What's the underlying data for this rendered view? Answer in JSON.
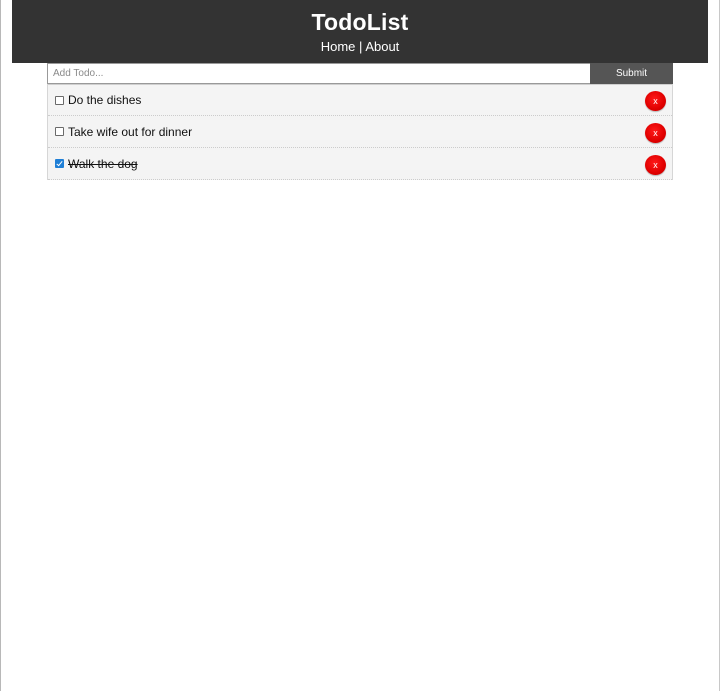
{
  "app": {
    "title": "TodoList"
  },
  "nav": {
    "home_label": "Home",
    "separator": "|",
    "about_label": "About"
  },
  "add_form": {
    "placeholder": "Add Todo...",
    "value": "",
    "submit_label": "Submit"
  },
  "todos": [
    {
      "title": "Do the dishes",
      "completed": false,
      "delete_label": "x"
    },
    {
      "title": "Take wife out for dinner",
      "completed": false,
      "delete_label": "x"
    },
    {
      "title": "Walk the dog",
      "completed": true,
      "delete_label": "x"
    }
  ],
  "colors": {
    "header_bg": "#333333",
    "header_text": "#ffffff",
    "submit_bg": "#555555",
    "item_bg": "#f4f4f4",
    "delete_bg": "#e00000",
    "checkbox_checked": "#1f7fd6"
  }
}
